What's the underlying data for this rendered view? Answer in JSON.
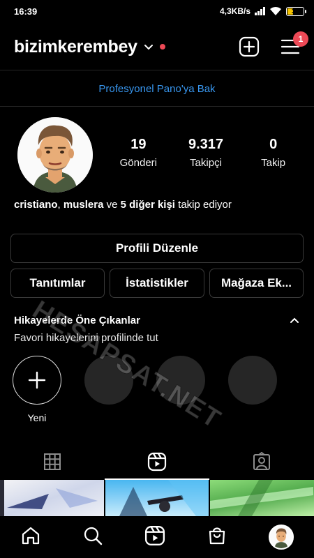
{
  "statusbar": {
    "time": "16:39",
    "speed": "4,3KB/s",
    "battery": "35"
  },
  "header": {
    "username": "bizimkerembey",
    "notif_count": "1"
  },
  "pro_link": "Profesyonel Pano'ya Bak",
  "stats": [
    {
      "value": "19",
      "label": "Gönderi"
    },
    {
      "value": "9.317",
      "label": "Takipçi"
    },
    {
      "value": "0",
      "label": "Takip"
    }
  ],
  "followed_by": {
    "name1": "cristiano",
    "sep": ", ",
    "name2": "muslera",
    "mid": " ve ",
    "others": "5 diğer kişi",
    "tail": " takip ediyor"
  },
  "buttons": {
    "edit": "Profili Düzenle",
    "promotions": "Tanıtımlar",
    "insights": "İstatistikler",
    "shop": "Mağaza Ek..."
  },
  "highlights": {
    "title": "Hikayelerde Öne Çıkanlar",
    "subtitle": "Favori hikayelerini profilinde tut",
    "new_label": "Yeni"
  },
  "watermark": "HESAPSAT.NET",
  "tabs": [
    "grid-icon",
    "reels-icon",
    "tagged-icon"
  ],
  "bottom_nav": [
    "home-icon",
    "search-icon",
    "reels-icon",
    "shop-icon",
    "profile-avatar"
  ],
  "colors": {
    "accent": "#3897f0",
    "badge": "#ed4956",
    "battery": "#f5c400"
  }
}
